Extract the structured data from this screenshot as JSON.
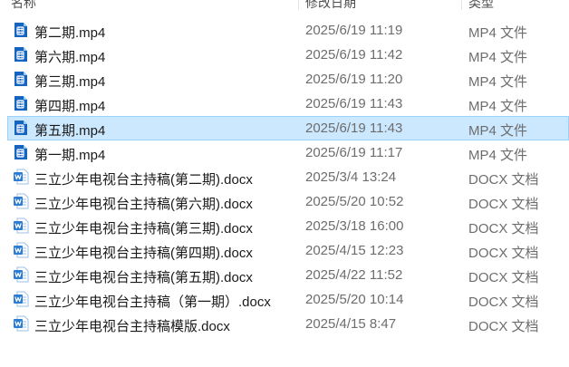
{
  "columns": {
    "name": "名称",
    "date": "修改日期",
    "type": "类型"
  },
  "colors": {
    "selected_bg": "#cce8ff",
    "selected_border": "#99d1ff",
    "video_icon": "#1565c0",
    "word_icon": "#2b7cd3"
  },
  "files": [
    {
      "name": "第二期.mp4",
      "date": "2025/6/19 11:19",
      "type": "MP4 文件",
      "icon": "video-file-icon"
    },
    {
      "name": "第六期.mp4",
      "date": "2025/6/19 11:42",
      "type": "MP4 文件",
      "icon": "video-file-icon"
    },
    {
      "name": "第三期.mp4",
      "date": "2025/6/19 11:20",
      "type": "MP4 文件",
      "icon": "video-file-icon"
    },
    {
      "name": "第四期.mp4",
      "date": "2025/6/19 11:43",
      "type": "MP4 文件",
      "icon": "video-file-icon"
    },
    {
      "name": "第五期.mp4",
      "date": "2025/6/19 11:43",
      "type": "MP4 文件",
      "icon": "video-file-icon",
      "selected": true
    },
    {
      "name": "第一期.mp4",
      "date": "2025/6/19 11:17",
      "type": "MP4 文件",
      "icon": "video-file-icon"
    },
    {
      "name": "三立少年电视台主持稿(第二期).docx",
      "date": "2025/3/4 13:24",
      "type": "DOCX 文档",
      "icon": "word-doc-icon"
    },
    {
      "name": "三立少年电视台主持稿(第六期).docx",
      "date": "2025/5/20 10:52",
      "type": "DOCX 文档",
      "icon": "word-doc-icon"
    },
    {
      "name": "三立少年电视台主持稿(第三期).docx",
      "date": "2025/3/18 16:00",
      "type": "DOCX 文档",
      "icon": "word-doc-icon"
    },
    {
      "name": "三立少年电视台主持稿(第四期).docx",
      "date": "2025/4/15 12:23",
      "type": "DOCX 文档",
      "icon": "word-doc-icon"
    },
    {
      "name": "三立少年电视台主持稿(第五期).docx",
      "date": "2025/4/22 11:52",
      "type": "DOCX 文档",
      "icon": "word-doc-icon"
    },
    {
      "name": "三立少年电视台主持稿（第一期）.docx",
      "date": "2025/5/20 10:14",
      "type": "DOCX 文档",
      "icon": "word-doc-icon"
    },
    {
      "name": "三立少年电视台主持稿模版.docx",
      "date": "2025/4/15 8:47",
      "type": "DOCX 文档",
      "icon": "word-doc-icon"
    }
  ]
}
